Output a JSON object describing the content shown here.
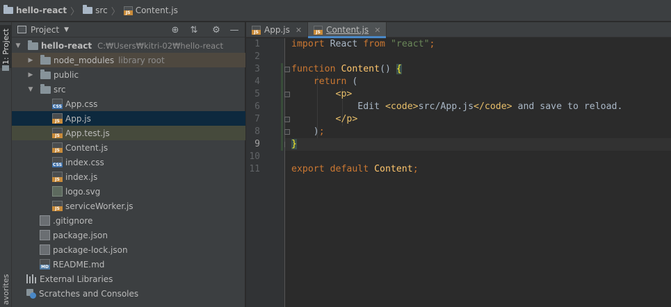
{
  "breadcrumb": {
    "project": "hello-react",
    "folder": "src",
    "file": "Content.js"
  },
  "toolstrip": {
    "project_label": "1: Project",
    "favorites_label": "avorites"
  },
  "panel": {
    "title": "Project",
    "tree": [
      {
        "label": "hello-react",
        "hint": "C:₩Users₩kitri-02₩hello-react",
        "kind": "folder",
        "depth": 0,
        "arrow": "down",
        "bold": true
      },
      {
        "label": "node_modules",
        "hint": "library root",
        "kind": "folder",
        "depth": 1,
        "arrow": "right"
      },
      {
        "label": "public",
        "hint": "",
        "kind": "folder",
        "depth": 1,
        "arrow": "right"
      },
      {
        "label": "src",
        "hint": "",
        "kind": "folder",
        "depth": 1,
        "arrow": "down"
      },
      {
        "label": "App.css",
        "kind": "css",
        "depth": 2
      },
      {
        "label": "App.js",
        "kind": "js",
        "depth": 2
      },
      {
        "label": "App.test.js",
        "kind": "js",
        "depth": 2
      },
      {
        "label": "Content.js",
        "kind": "js",
        "depth": 2
      },
      {
        "label": "index.css",
        "kind": "css",
        "depth": 2
      },
      {
        "label": "index.js",
        "kind": "js",
        "depth": 2
      },
      {
        "label": "logo.svg",
        "kind": "svg",
        "depth": 2
      },
      {
        "label": "serviceWorker.js",
        "kind": "js",
        "depth": 2
      },
      {
        "label": ".gitignore",
        "kind": "doc",
        "depth": 1
      },
      {
        "label": "package.json",
        "kind": "doc",
        "depth": 1
      },
      {
        "label": "package-lock.json",
        "kind": "doc",
        "depth": 1
      },
      {
        "label": "README.md",
        "kind": "md",
        "depth": 1
      },
      {
        "label": "External Libraries",
        "kind": "lib",
        "depth": 0
      },
      {
        "label": "Scratches and Consoles",
        "kind": "scratch",
        "depth": 0
      }
    ]
  },
  "tabs": [
    {
      "label": "App.js",
      "active": false
    },
    {
      "label": "Content.js",
      "active": true
    }
  ],
  "editor": {
    "line_numbers": [
      "1",
      "2",
      "3",
      "4",
      "5",
      "6",
      "7",
      "8",
      "9",
      "10",
      "11"
    ],
    "current_line": 9
  },
  "icons": {
    "folder": "folder-icon",
    "css": "css-file-icon",
    "js": "js-file-icon",
    "close": "close-icon"
  },
  "colors": {
    "keyword": "#cc7832",
    "string": "#6a8759",
    "function": "#ffc66d",
    "tag": "#e8bf6a",
    "accent": "#4a88c7"
  }
}
